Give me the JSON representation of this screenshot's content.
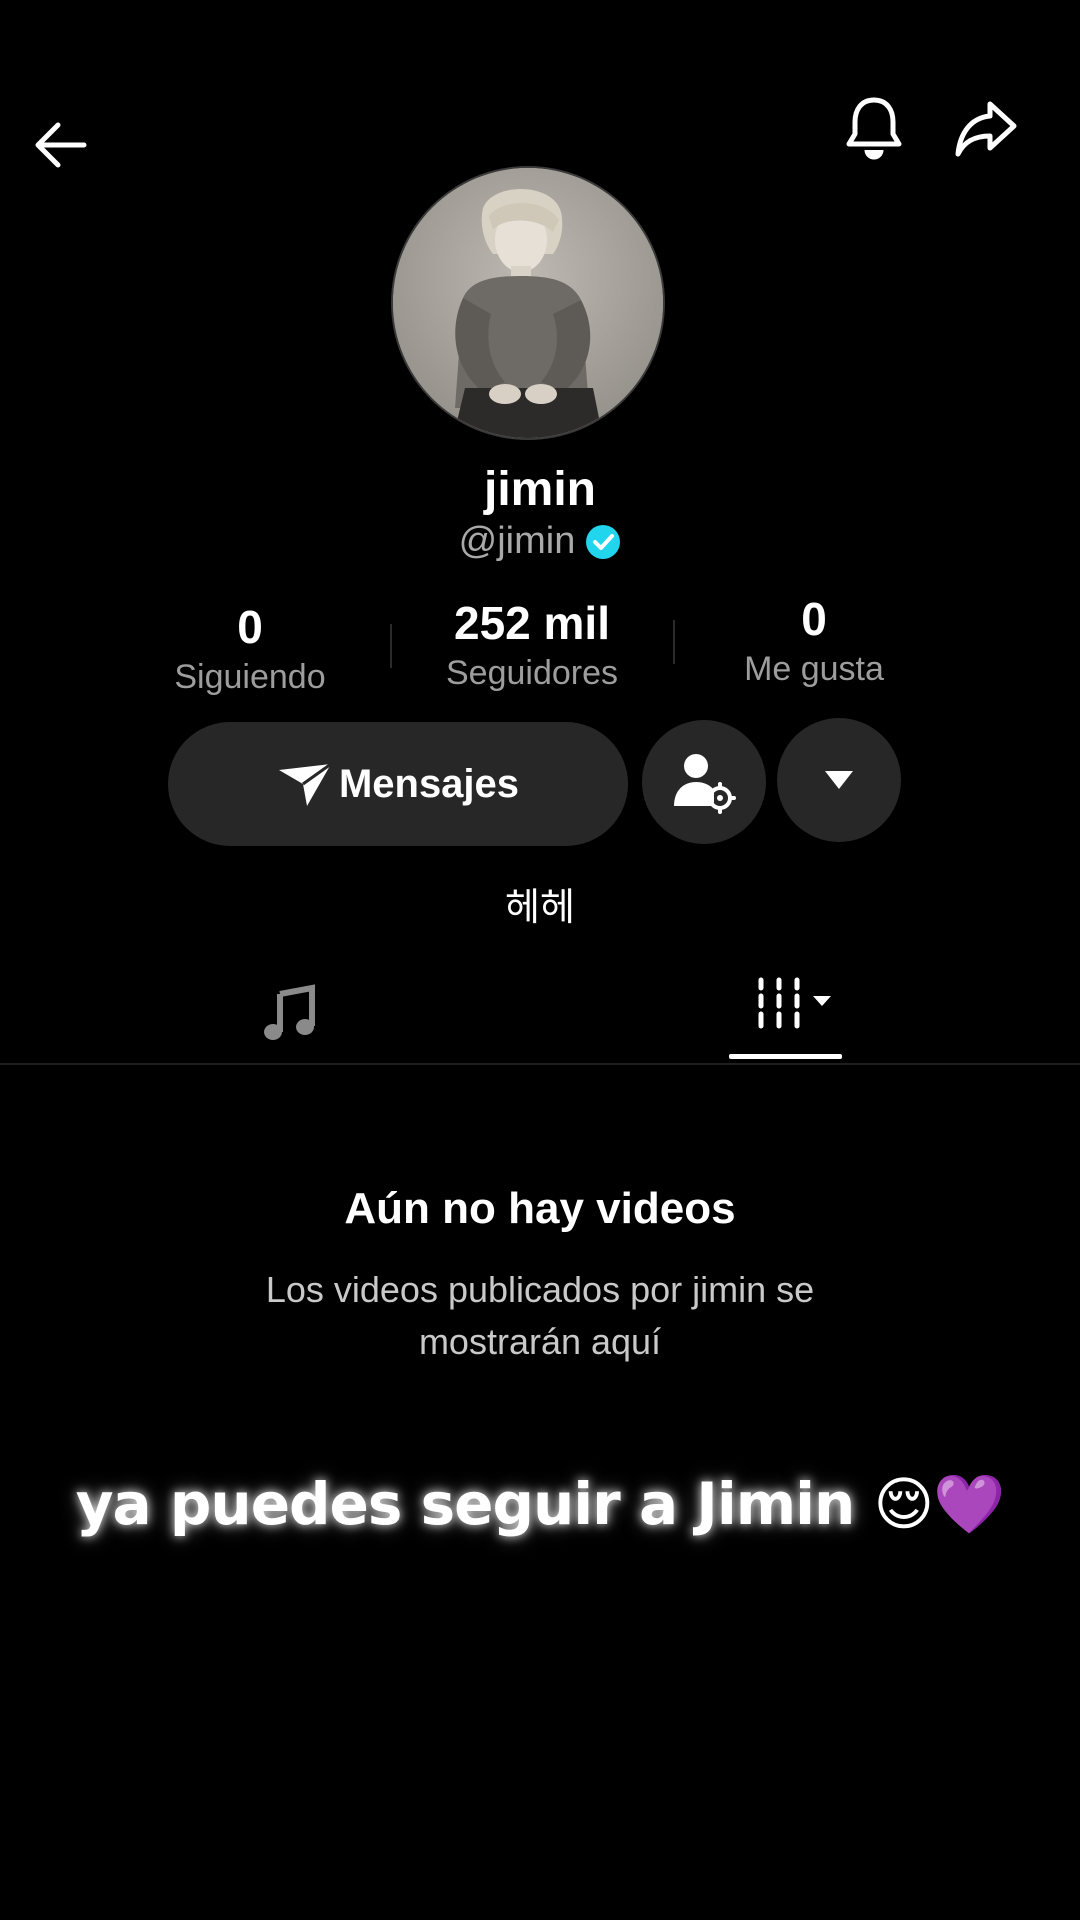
{
  "profile": {
    "display_name": "jimin",
    "handle": "@jimin",
    "verified_color": "#20d5ec",
    "bio": "헤헤"
  },
  "stats": {
    "following": {
      "value": "0",
      "label": "Siguiendo"
    },
    "followers": {
      "value": "252 mil",
      "label": "Seguidores"
    },
    "likes": {
      "value": "0",
      "label": "Me gusta"
    }
  },
  "actions": {
    "message_label": "Mensajes"
  },
  "icons": {
    "back": "arrow-left-icon",
    "notifications": "bell-icon",
    "share": "share-arrow-icon",
    "message": "paper-plane-icon",
    "add_friend": "user-settings-icon",
    "more": "triangle-down-icon",
    "music_tab": "music-note-icon",
    "videos_tab": "grid-lines-icon"
  },
  "empty_state": {
    "title": "Aún no hay videos",
    "description": "Los videos publicados por jimin se mostrarán aquí"
  },
  "overlay": {
    "caption_text": "ya puedes seguir a Jimin",
    "caption_emoji": "😌💜"
  }
}
